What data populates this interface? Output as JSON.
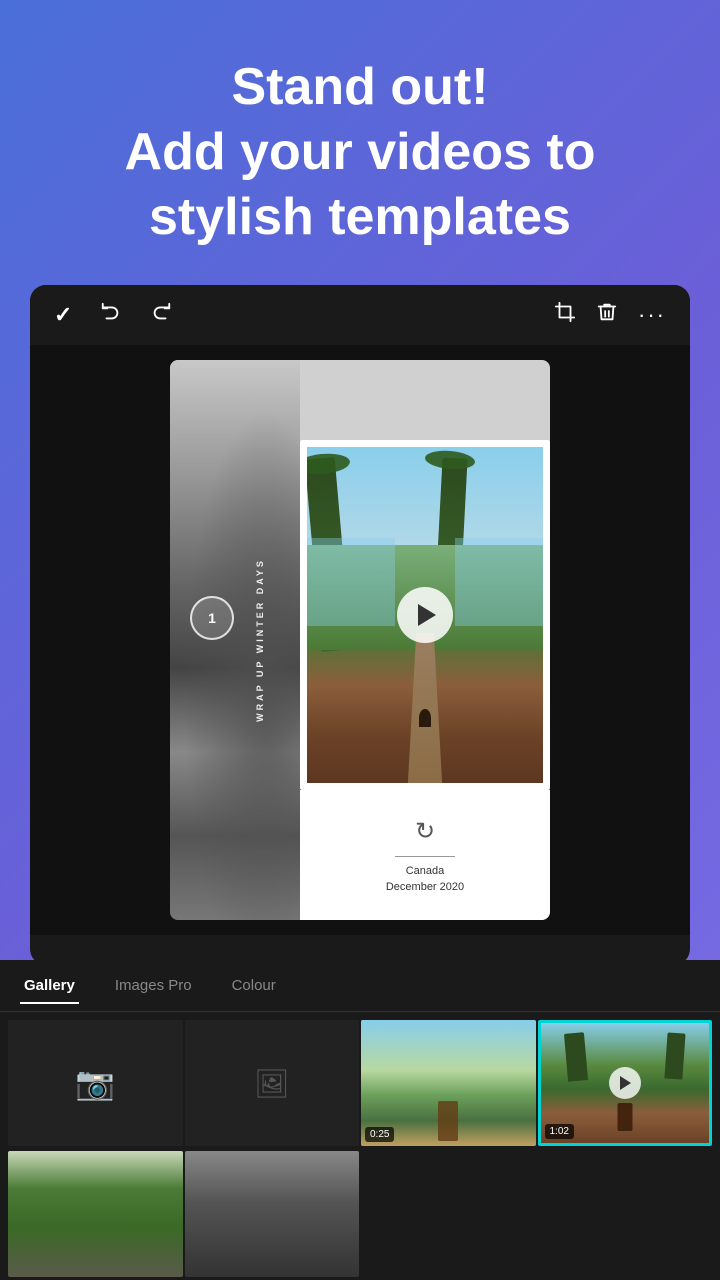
{
  "header": {
    "line1": "Stand out!",
    "line2": "Add your videos to",
    "line3": "stylish templates"
  },
  "toolbar": {
    "check_icon": "✓",
    "undo_icon": "↩",
    "redo_icon": "↪",
    "crop_label": "crop",
    "delete_label": "delete",
    "more_label": "more"
  },
  "template": {
    "number": "1",
    "vertical_text": "WRAP UP  WINTER DAYS",
    "location": "Canada",
    "date": "December 2020"
  },
  "tabs": [
    {
      "id": "gallery",
      "label": "Gallery",
      "active": true
    },
    {
      "id": "images_pro",
      "label": "Images Pro",
      "active": false
    },
    {
      "id": "colour",
      "label": "Colour",
      "active": false
    }
  ],
  "gallery": {
    "cells": [
      {
        "type": "camera",
        "label": "Camera"
      },
      {
        "type": "gallery_icon",
        "label": "Gallery"
      },
      {
        "type": "photo",
        "class": "thumb-video-1",
        "duration": "0:25"
      },
      {
        "type": "photo_selected",
        "class": "thumb-video-2",
        "duration": "1:02"
      },
      {
        "type": "photo",
        "class": "thumb-forest"
      },
      {
        "type": "photo",
        "class": "thumb-dark"
      }
    ]
  },
  "colors": {
    "background_start": "#4a6fd8",
    "background_end": "#7b6fe8",
    "editor_bg": "#1a1a1a",
    "accent_teal": "#00d4d4"
  }
}
